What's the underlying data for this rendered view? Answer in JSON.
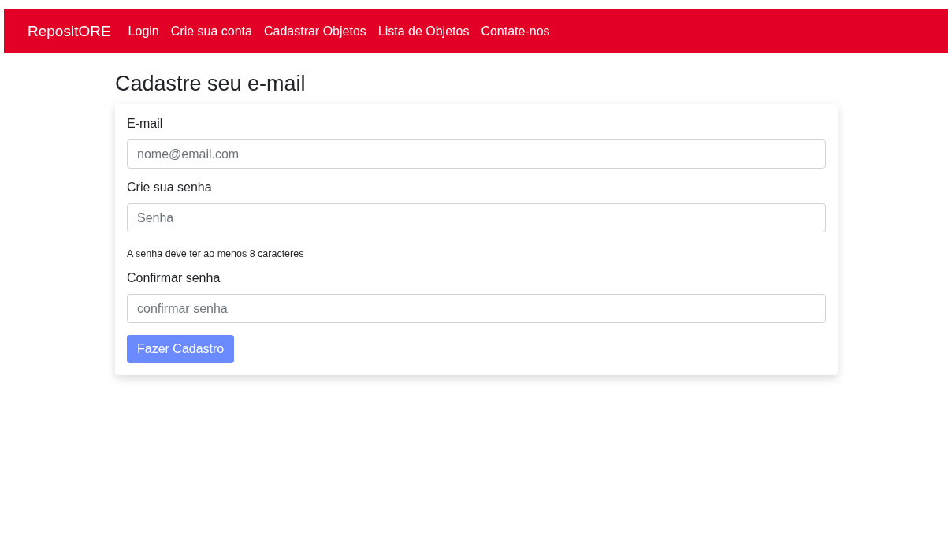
{
  "navbar": {
    "brand": "RepositORE",
    "links": [
      "Login",
      "Crie sua conta",
      "Cadastrar Objetos",
      "Lista de Objetos",
      "Contate-nos"
    ]
  },
  "heading": "Cadastre seu e-mail",
  "form": {
    "fields": [
      {
        "label": "E-mail",
        "placeholder": "nome@email.com"
      },
      {
        "label": "Crie sua senha",
        "placeholder": "Senha",
        "help": "A senha deve ter ao menos 8 caracteres"
      },
      {
        "label": "Confirmar senha",
        "placeholder": "confirmar senha"
      }
    ],
    "submit": {
      "label": "Fazer Cadastro",
      "disabled": true
    }
  }
}
